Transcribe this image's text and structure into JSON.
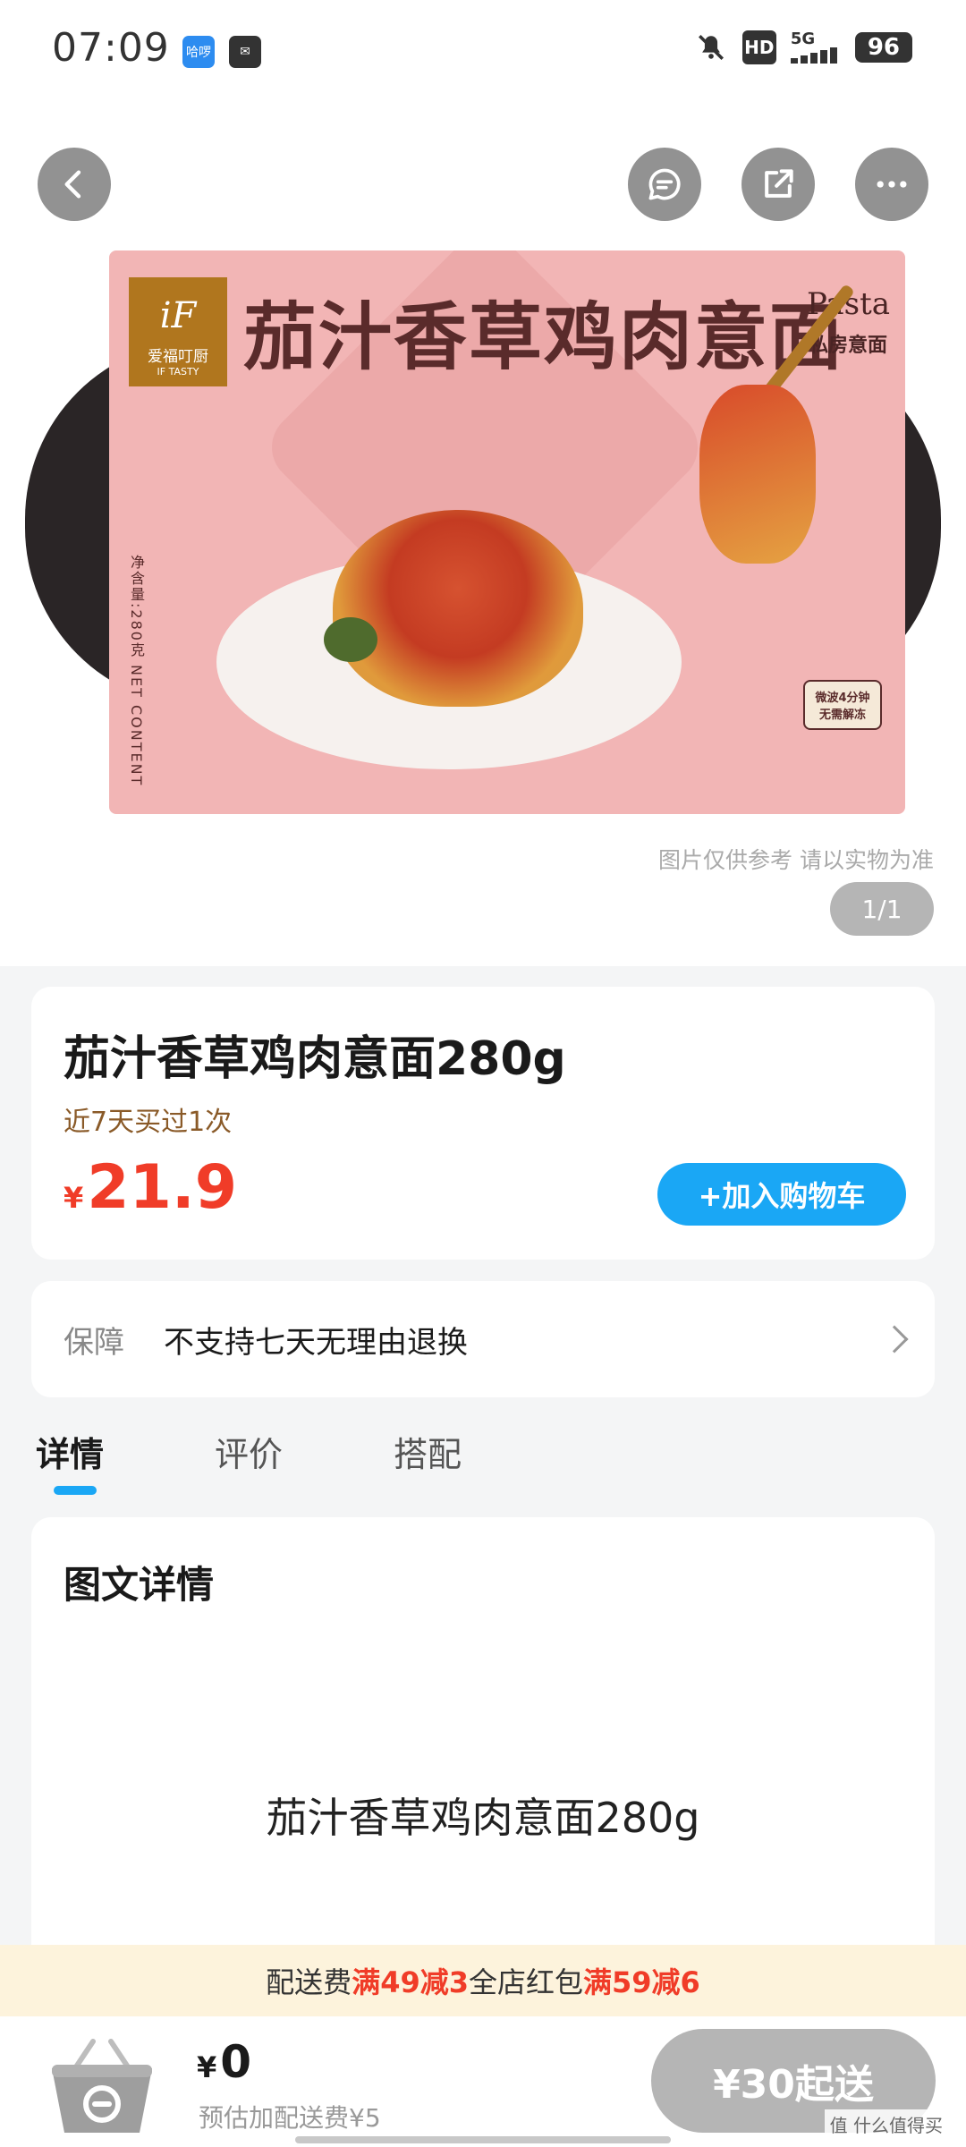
{
  "status_bar": {
    "time": "07:09",
    "app_badge_1": "哈啰",
    "app_badge_2": "✉",
    "hd": "HD",
    "network": "5G",
    "battery": "96",
    "icons": [
      "mute-icon",
      "hd-icon",
      "signal-icon",
      "battery-icon"
    ]
  },
  "hero": {
    "package_brand": "爱福叮厨",
    "package_brand_en": "IF TASTY",
    "package_title": "茄汁香草鸡肉意面",
    "package_sub_en": "Pasta",
    "package_sub_cn": "私房意面",
    "package_net": "净含量:280克  NET CONTENT",
    "package_badge_1": "微波4分钟",
    "package_badge_2": "无需解冻",
    "image_note": "图片仅供参考 请以实物为准",
    "image_counter": "1/1"
  },
  "product": {
    "title": "茄汁香草鸡肉意面280g",
    "sales_note": "近7天买过1次",
    "currency": "¥",
    "price": "21.9",
    "add_to_cart": "+加入购物车"
  },
  "guarantee": {
    "label": "保障",
    "value": "不支持七天无理由退换"
  },
  "tabs": [
    {
      "label": "详情",
      "active": true
    },
    {
      "label": "评价",
      "active": false
    },
    {
      "label": "搭配",
      "active": false
    }
  ],
  "detail": {
    "heading": "图文详情",
    "text": "茄汁香草鸡肉意面280g"
  },
  "promo": {
    "part1": "配送费",
    "part2": "满49减3",
    "part3": "全店红包",
    "part4": "满59减6"
  },
  "bottom_bar": {
    "currency": "¥",
    "amount": "0",
    "fee_note": "预估加配送费¥5",
    "min_order": "¥30起送",
    "watermark": "值 什么值得买"
  },
  "colors": {
    "accent_blue": "#1aa7f5",
    "price_red": "#f03c28",
    "promo_bg": "#fdf3dc"
  }
}
